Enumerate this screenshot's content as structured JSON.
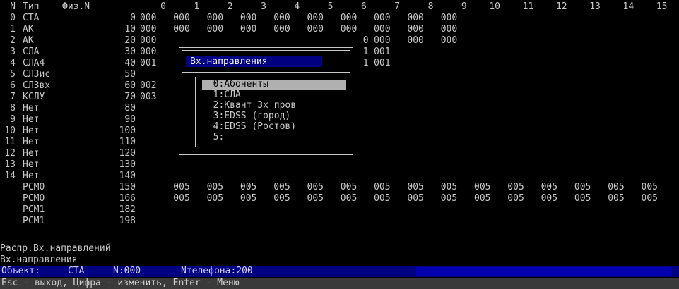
{
  "header": {
    "n": "N",
    "type": "Тип",
    "phys": "Физ.N",
    "cols": [
      "0",
      "1",
      "2",
      "3",
      "4",
      "5",
      "6",
      "7",
      "8",
      "9",
      "10",
      "11",
      "12",
      "13",
      "14",
      "15"
    ]
  },
  "rows": [
    {
      "n": "0",
      "type": "СТА",
      "phys": "0",
      "cells": [
        "000",
        "000",
        "000",
        "000",
        "000",
        "000",
        "000",
        "000",
        "000",
        "000",
        "",
        "",
        "",
        "",
        "",
        ""
      ]
    },
    {
      "n": "1",
      "type": "АК",
      "phys": "10",
      "cells": [
        "000",
        "000",
        "000",
        "000",
        "000",
        "000",
        "000",
        "000",
        "000",
        "000",
        "",
        "",
        "",
        "",
        "",
        ""
      ]
    },
    {
      "n": "2",
      "type": "АК",
      "phys": "20",
      "cells": [
        "000",
        "",
        "",
        "",
        "",
        "",
        "0",
        "000",
        "000",
        "000",
        "",
        "",
        "",
        "",
        "",
        ""
      ]
    },
    {
      "n": "3",
      "type": "СЛА",
      "phys": "30",
      "cells": [
        "000",
        "",
        "",
        "",
        "",
        "",
        "1",
        "001",
        "",
        "",
        "",
        "",
        "",
        "",
        "",
        ""
      ]
    },
    {
      "n": "4",
      "type": "СЛА4",
      "phys": "40",
      "cells": [
        "001",
        "",
        "",
        "",
        "",
        "",
        "1",
        "001",
        "",
        "",
        "",
        "",
        "",
        "",
        "",
        ""
      ]
    },
    {
      "n": "5",
      "type": "СЛЗис",
      "phys": "50",
      "cells": [
        "",
        "",
        "",
        "",
        "",
        "",
        "",
        "",
        "",
        "",
        "",
        "",
        "",
        "",
        "",
        ""
      ]
    },
    {
      "n": "6",
      "type": "СЛЗвх",
      "phys": "60",
      "cells": [
        "002",
        "",
        "",
        "",
        "",
        "",
        "",
        "",
        "",
        "",
        "",
        "",
        "",
        "",
        "",
        ""
      ]
    },
    {
      "n": "7",
      "type": "КСЛУ",
      "phys": "70",
      "cells": [
        "003",
        "",
        "",
        "",
        "",
        "",
        "",
        "",
        "",
        "",
        "",
        "",
        "",
        "",
        "",
        ""
      ]
    },
    {
      "n": "8",
      "type": "Нет",
      "phys": "80",
      "cells": [
        "",
        "",
        "",
        "",
        "",
        "",
        "",
        "",
        "",
        "",
        "",
        "",
        "",
        "",
        "",
        ""
      ]
    },
    {
      "n": "9",
      "type": "Нет",
      "phys": "90",
      "cells": [
        "",
        "",
        "",
        "",
        "",
        "",
        "",
        "",
        "",
        "",
        "",
        "",
        "",
        "",
        "",
        ""
      ]
    },
    {
      "n": "10",
      "type": "Нет",
      "phys": "100",
      "cells": [
        "",
        "",
        "",
        "",
        "",
        "",
        "",
        "",
        "",
        "",
        "",
        "",
        "",
        "",
        "",
        ""
      ]
    },
    {
      "n": "11",
      "type": "Нет",
      "phys": "110",
      "cells": [
        "",
        "",
        "",
        "",
        "",
        "",
        "",
        "",
        "",
        "",
        "",
        "",
        "",
        "",
        "",
        ""
      ]
    },
    {
      "n": "12",
      "type": "Нет",
      "phys": "120",
      "cells": [
        "",
        "",
        "",
        "",
        "",
        "",
        "",
        "",
        "",
        "",
        "",
        "",
        "",
        "",
        "",
        ""
      ]
    },
    {
      "n": "13",
      "type": "Нет",
      "phys": "130",
      "cells": [
        "",
        "",
        "",
        "",
        "",
        "",
        "",
        "",
        "",
        "",
        "",
        "",
        "",
        "",
        "",
        ""
      ]
    },
    {
      "n": "14",
      "type": "Нет",
      "phys": "140",
      "cells": [
        "",
        "",
        "",
        "",
        "",
        "",
        "",
        "",
        "",
        "",
        "",
        "",
        "",
        "",
        "",
        ""
      ]
    },
    {
      "n": "",
      "type": "PCM0",
      "phys": "150",
      "cells": [
        "",
        "005",
        "005",
        "005",
        "005",
        "005",
        "005",
        "005",
        "005",
        "005",
        "005",
        "005",
        "005",
        "005",
        "005",
        "005"
      ]
    },
    {
      "n": "",
      "type": "PCM0",
      "phys": "166",
      "cells": [
        "",
        "005",
        "005",
        "005",
        "005",
        "005",
        "005",
        "005",
        "005",
        "005",
        "005",
        "005",
        "005",
        "005",
        "005",
        "005"
      ]
    },
    {
      "n": "",
      "type": "PCM1",
      "phys": "182",
      "cells": [
        "",
        "",
        "",
        "",
        "",
        "",
        "",
        "",
        "",
        "",
        "",
        "",
        "",
        "",
        "",
        ""
      ]
    },
    {
      "n": "",
      "type": "PCM1",
      "phys": "198",
      "cells": [
        "",
        "",
        "",
        "",
        "",
        "",
        "",
        "",
        "",
        "",
        "",
        "",
        "",
        "",
        "",
        ""
      ]
    }
  ],
  "status": {
    "line1": "Распр.Вх.направлений",
    "line2": "Вх.направления",
    "object_label": "Объект:",
    "object_type": "СТА",
    "object_n": "N:000",
    "object_phone": "Nтелефона:200",
    "help": "Esc - выход, Цифра - изменить, Enter - Меню"
  },
  "dialog": {
    "title": "Вх.направления",
    "options": [
      {
        "label": "0:Абоненты",
        "selected": true
      },
      {
        "label": "1:СЛА",
        "selected": false
      },
      {
        "label": "2:Квант 3х пров",
        "selected": false
      },
      {
        "label": "3:EDSS (город)",
        "selected": false
      },
      {
        "label": "4:EDSS (Ростов)",
        "selected": false
      },
      {
        "label": "5:",
        "selected": false
      }
    ]
  },
  "colors": {
    "background": "#000000",
    "text": "#c8c8c8",
    "title_bar": "#000080",
    "selection": "#b0b0b0"
  }
}
